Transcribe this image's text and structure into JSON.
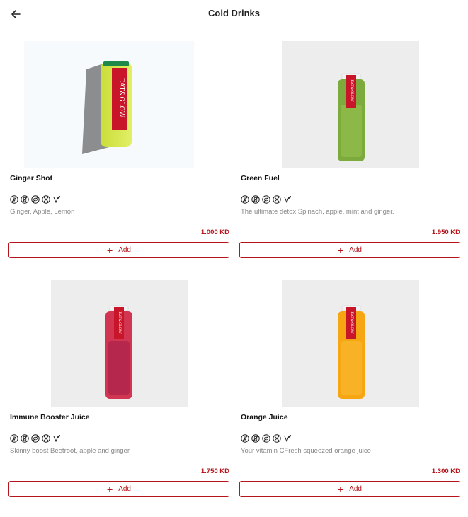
{
  "header": {
    "title": "Cold Drinks",
    "back_icon": "arrow-left-icon"
  },
  "products": [
    {
      "name": "Ginger Shot",
      "description": "Ginger, Apple, Lemon",
      "price": "1.000 KD",
      "add_label": "Add",
      "bottle_label": "EAT&GLOW"
    },
    {
      "name": "Green Fuel",
      "description": "The ultimate detox Spinach, apple, mint and ginger.",
      "price": "1.950 KD",
      "add_label": "Add",
      "bottle_label": "EAT&GLOW"
    },
    {
      "name": "Immune Booster Juice",
      "description": "Skinny boost Beetroot, apple and ginger",
      "price": "1.750 KD",
      "add_label": "Add",
      "bottle_label": "EAT&GLOW"
    },
    {
      "name": "Orange Juice",
      "description": "Your vitamin CFresh squeezed orange juice",
      "price": "1.300 KD",
      "add_label": "Add",
      "bottle_label": "EAT&GLOW"
    }
  ],
  "diet_icons": [
    "gluten-free-icon",
    "dairy-free-icon",
    "nut-free-icon",
    "no-sugar-icon",
    "vegan-icon"
  ],
  "colors": {
    "accent": "#b5141b",
    "divider": "#e4e4e4",
    "description_text": "#888888"
  }
}
